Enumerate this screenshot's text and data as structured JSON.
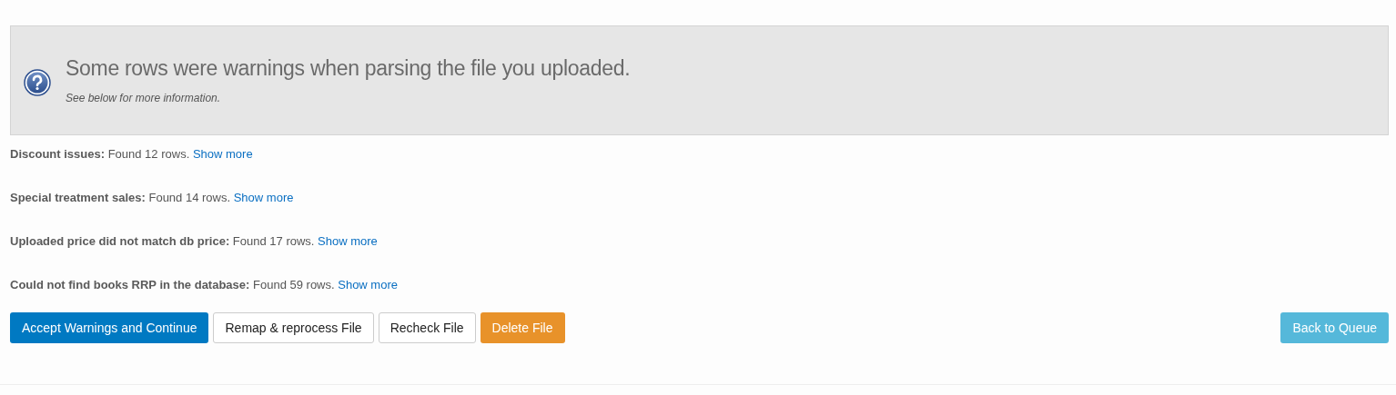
{
  "alert": {
    "title": "Some rows were warnings when parsing the file you uploaded.",
    "subtitle": "See below for more information."
  },
  "issues": [
    {
      "text": "**Discount issues:** Found 12 rows.",
      "link": "Show more"
    },
    {
      "text": "**Special treatment sales:** Found 14 rows.",
      "link": "Show more"
    },
    {
      "text": "**Uploaded price did not match db price:** Found 17 rows.",
      "link": "Show more"
    },
    {
      "text": "**Could not find books RRP in the database:** Found 59 rows.",
      "link": "Show more"
    }
  ],
  "buttons": [
    {
      "label": "Accept Warnings and Continue",
      "kind": "primary"
    },
    {
      "label": "Remap & reprocess File",
      "kind": "default"
    },
    {
      "label": "Recheck File",
      "kind": "default"
    },
    {
      "label": "Delete File",
      "kind": "warning"
    }
  ],
  "back_button": {
    "label": "Back to Queue",
    "kind": "info"
  }
}
